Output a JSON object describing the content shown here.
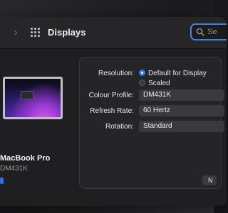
{
  "toolbar": {
    "title": "Displays",
    "forward_glyph": "›",
    "search_placeholder": "Se"
  },
  "device": {
    "name": "MacBook Pro",
    "model": "DM431K"
  },
  "settings": {
    "resolution_label": "Resolution:",
    "resolution_options": [
      {
        "label": "Default for Display",
        "selected": true
      },
      {
        "label": "Scaled",
        "selected": false
      }
    ],
    "colour_profile_label": "Colour Profile:",
    "colour_profile_value": "DM431K",
    "refresh_rate_label": "Refresh Rate:",
    "refresh_rate_value": "60 Hertz",
    "rotation_label": "Rotation:",
    "rotation_value": "Standard"
  },
  "corner_button_label": "N",
  "colors": {
    "accent": "#2f7df0",
    "search_focus": "#3d82e0"
  },
  "icons": [
    "grid-icon",
    "search-icon",
    "chevron-right-icon"
  ]
}
